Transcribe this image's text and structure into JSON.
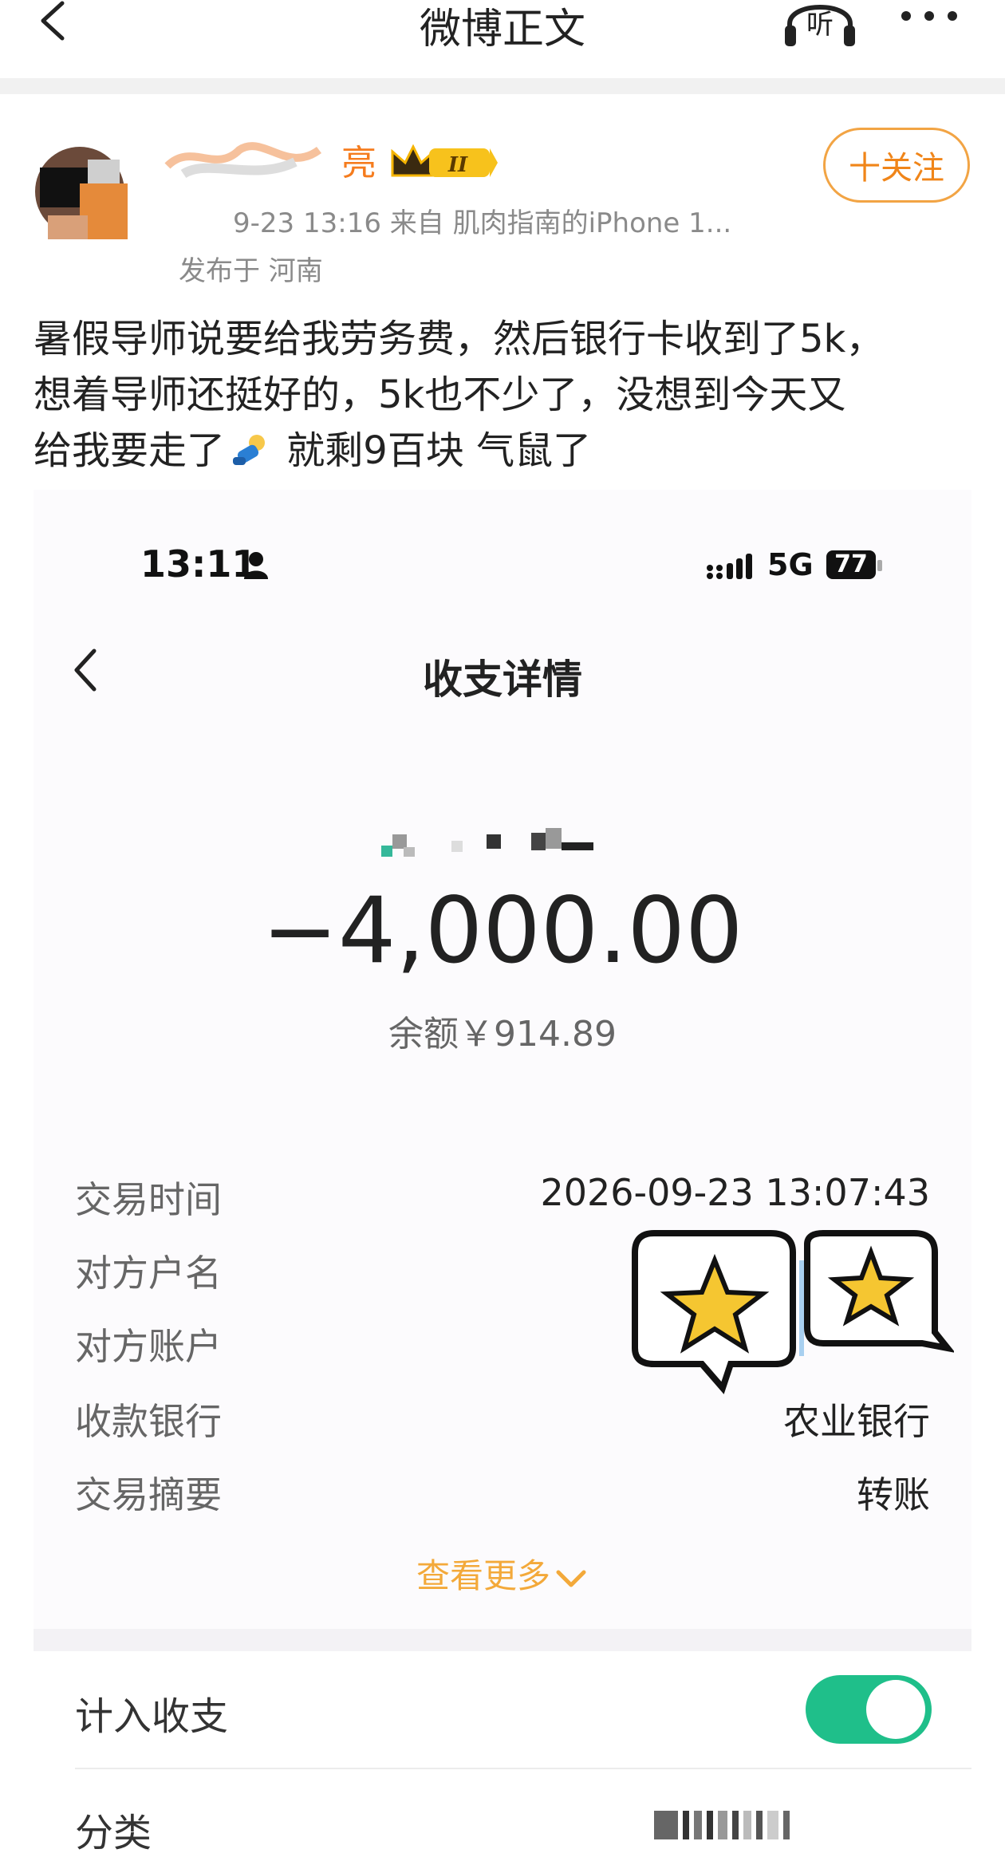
{
  "topbar": {
    "title": "微博正文",
    "listen_label": "听"
  },
  "author": {
    "name": "亮",
    "vip_level": "II",
    "meta": "9-23 13:16   来自 肌肉指南的iPhone 1...",
    "location": "发布于 河南",
    "follow_label": "十关注"
  },
  "post": {
    "line1": "暑假导师说要给我劳务费，然后银行卡收到了5k，",
    "line2": "想着导师还挺好的，5k也不少了，没想到今天又",
    "line3_a": "给我要走了",
    "line3_b": " 就剩9百块   气鼠了"
  },
  "screenshot": {
    "status_time": "13:11",
    "network": "5G",
    "battery": "77",
    "title": "收支详情",
    "amount": "−4,000.00",
    "balance": "余额￥914.89",
    "rows": [
      {
        "label": "交易时间",
        "value": "2026-09-23 13:07:43"
      },
      {
        "label": "对方户名",
        "value": ""
      },
      {
        "label": "对方账户",
        "value": ""
      },
      {
        "label": "收款银行",
        "value": "农业银行"
      },
      {
        "label": "交易摘要",
        "value": "转账"
      }
    ],
    "more_link": "查看更多",
    "count_label": "计入收支",
    "toggle_on": true,
    "category_label": "分类"
  },
  "colors": {
    "accent_orange": "#f08519",
    "link_gold": "#f3a93a",
    "toggle_green": "#1fbf8a"
  }
}
